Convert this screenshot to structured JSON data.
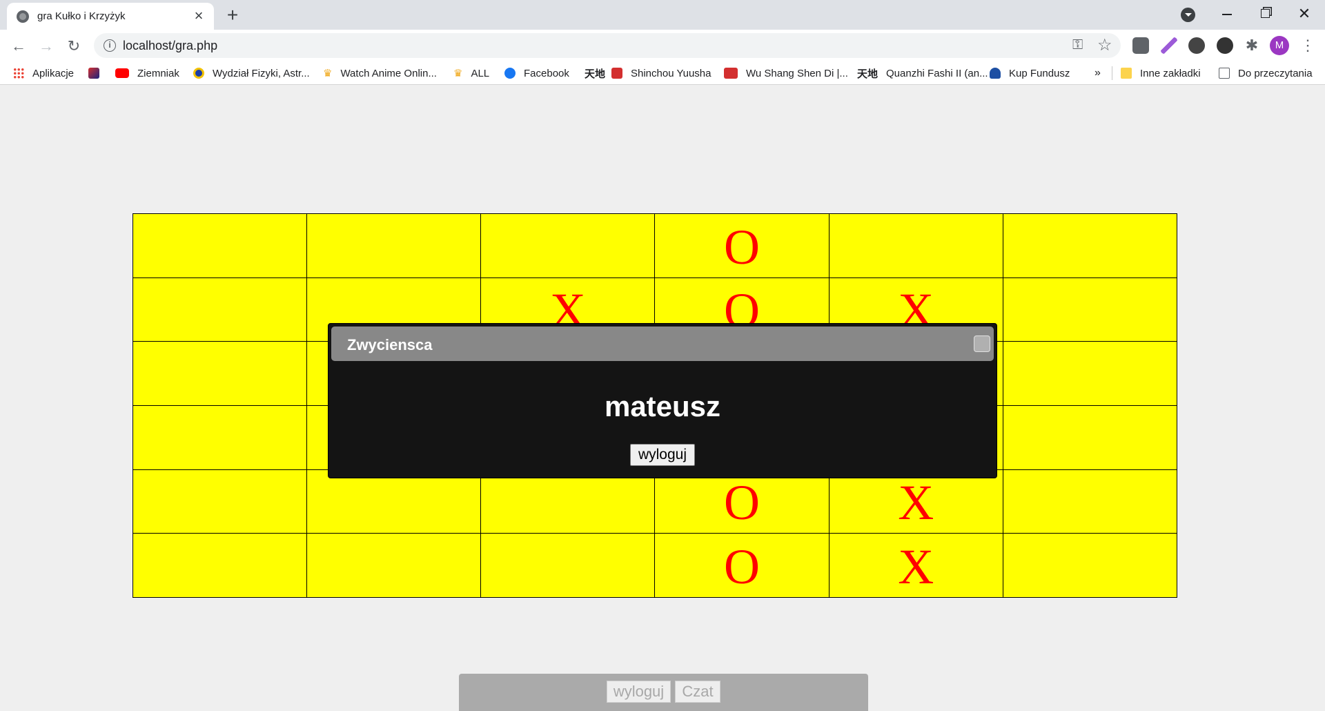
{
  "browser": {
    "tab_title": "gra Kułko i Krzyżyk",
    "tab_close": "×",
    "new_tab": "+",
    "url": "localhost/gra.php",
    "profile_initial": "M",
    "bookmarks": {
      "apps": "Aplikacje",
      "ziemniak": "Ziemniak",
      "wydzial": "Wydział Fizyki, Astr...",
      "watch": "Watch Anime Onlin...",
      "all": "ALL",
      "facebook": "Facebook",
      "kanji_1": "天地",
      "shinchou": "Shinchou Yuusha",
      "wushang": "Wu Shang Shen Di |...",
      "quanzhi_icon": "天地",
      "quanzhi": "Quanzhi Fashi II (an...",
      "kup": "Kup Fundusz",
      "more": "»",
      "inne": "Inne zakładki",
      "read": "Do przeczytania"
    }
  },
  "board": {
    "rows": [
      [
        "",
        "",
        "",
        "O",
        "",
        ""
      ],
      [
        "",
        "",
        "X",
        "O",
        "X",
        ""
      ],
      [
        "",
        "",
        "",
        "",
        "",
        ""
      ],
      [
        "",
        "",
        "",
        "",
        "",
        ""
      ],
      [
        "",
        "",
        "",
        "O",
        "X",
        ""
      ],
      [
        "",
        "",
        "",
        "O",
        "X",
        ""
      ]
    ],
    "cell_color": "#ffff00",
    "mark_color": "#ff0000"
  },
  "dialog": {
    "title": "Zwyciensca",
    "winner": "mateusz",
    "logout_label": "wyloguj"
  },
  "bottom_bar": {
    "logout_label": "wyloguj",
    "chat_label": "Czat"
  }
}
